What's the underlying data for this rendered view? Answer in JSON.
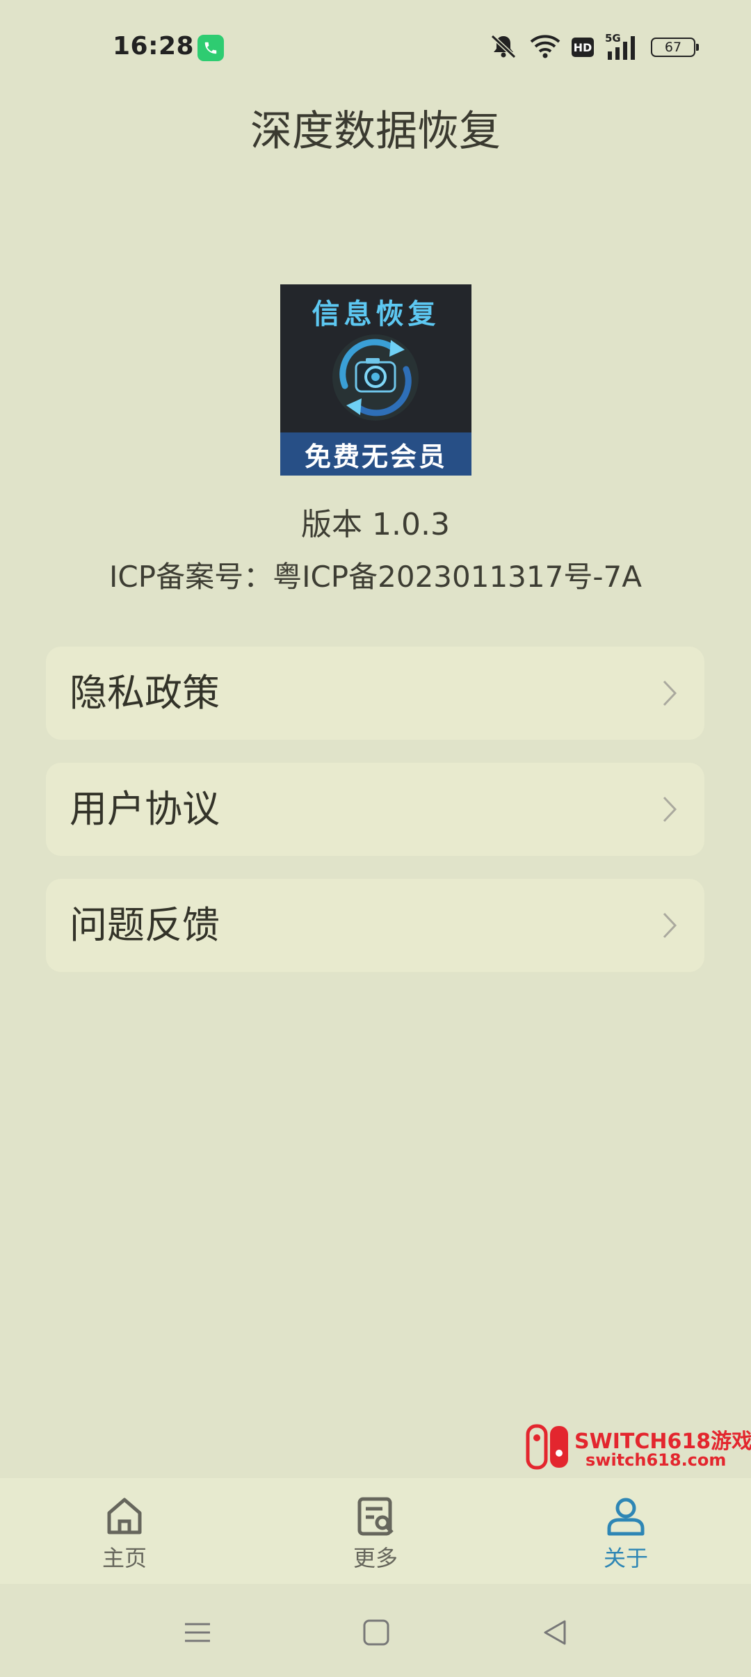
{
  "status_bar": {
    "time": "16:28",
    "call_icon": "phone-icon",
    "network": "5G",
    "hd": "HD",
    "battery": "67"
  },
  "app": {
    "title": "深度数据恢复"
  },
  "logo": {
    "top_text": "信息恢复",
    "bottom_text": "免费无会员",
    "icon": "camera-refresh-icon"
  },
  "about": {
    "version": "版本 1.0.3",
    "icp": "ICP备案号：粤ICP备2023011317号-7A"
  },
  "menu": {
    "items": [
      {
        "label": "隐私政策",
        "icon": "chevron-right-icon"
      },
      {
        "label": "用户协议",
        "icon": "chevron-right-icon"
      },
      {
        "label": "问题反馈",
        "icon": "chevron-right-icon"
      }
    ]
  },
  "watermark": {
    "line1": "SWITCH618游戏",
    "line2": "switch618.com"
  },
  "tabs": [
    {
      "label": "主页",
      "icon": "home-icon",
      "active": false
    },
    {
      "label": "更多",
      "icon": "document-search-icon",
      "active": false
    },
    {
      "label": "关于",
      "icon": "person-icon",
      "active": true
    }
  ],
  "colors": {
    "background": "#e0e3c9",
    "card": "#e8eace",
    "active_tab": "#2e86b5",
    "inactive_tab": "#66665c"
  }
}
